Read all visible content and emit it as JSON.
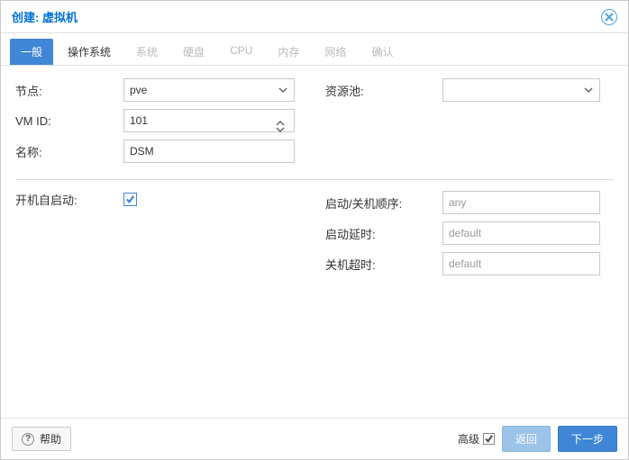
{
  "dialog": {
    "title": "创建: 虚拟机"
  },
  "tabs": [
    {
      "label": "一般",
      "state": "active"
    },
    {
      "label": "操作系统",
      "state": "enabled"
    },
    {
      "label": "系统",
      "state": "disabled"
    },
    {
      "label": "硬盘",
      "state": "disabled"
    },
    {
      "label": "CPU",
      "state": "disabled"
    },
    {
      "label": "内存",
      "state": "disabled"
    },
    {
      "label": "网络",
      "state": "disabled"
    },
    {
      "label": "确认",
      "state": "disabled"
    }
  ],
  "left": {
    "node_label": "节点:",
    "node_value": "pve",
    "vmid_label": "VM ID:",
    "vmid_value": "101",
    "name_label": "名称:",
    "name_value": "DSM",
    "autostart_label": "开机自启动:"
  },
  "right": {
    "pool_label": "资源池:",
    "pool_value": "",
    "order_label": "启动/关机顺序:",
    "order_value": "any",
    "delay_label": "启动延时:",
    "delay_value": "default",
    "shutdown_label": "关机超时:",
    "shutdown_value": "default"
  },
  "footer": {
    "help": "帮助",
    "advanced": "高级",
    "back": "返回",
    "next": "下一步"
  }
}
